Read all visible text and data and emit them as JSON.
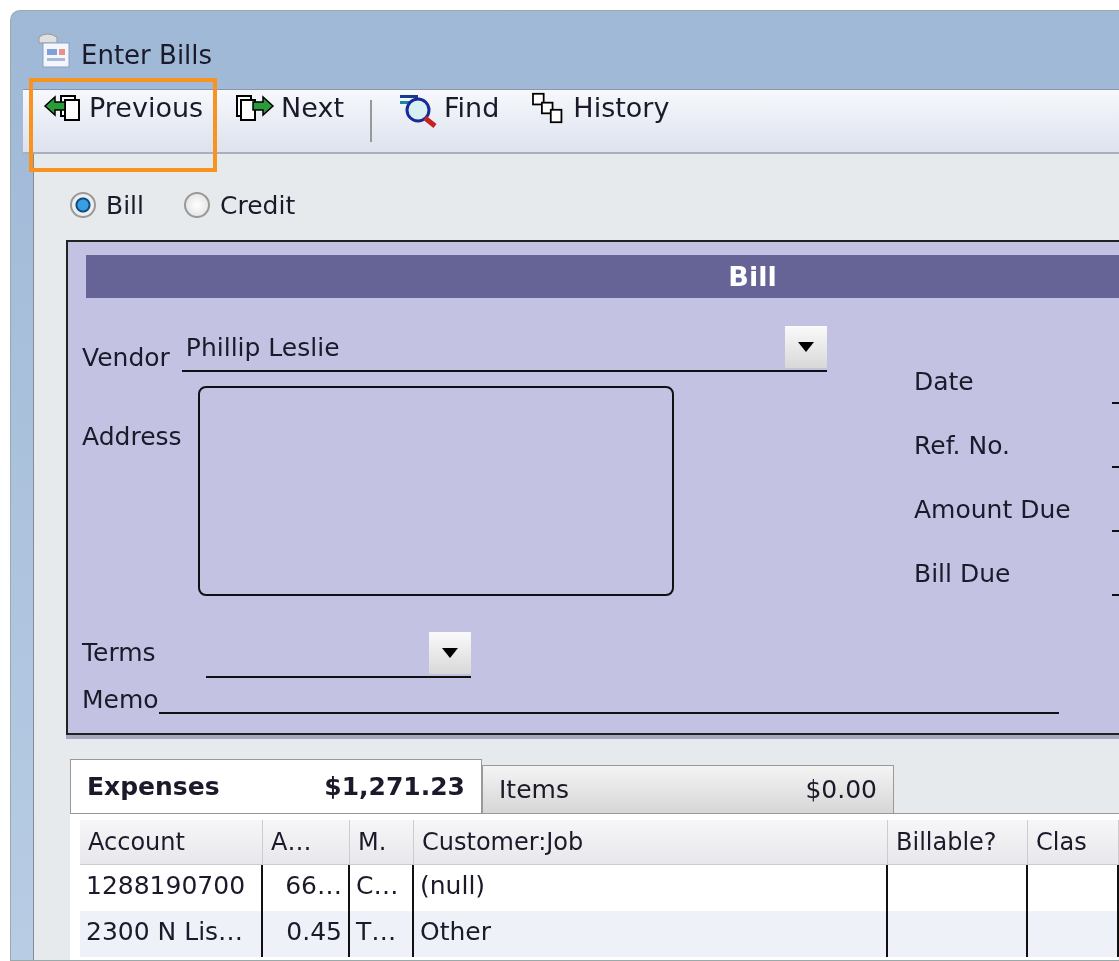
{
  "window": {
    "title": "Enter Bills"
  },
  "toolbar": [
    {
      "label": "Previous",
      "kind": "previous",
      "highlighted": true
    },
    {
      "label": "Next",
      "kind": "next",
      "highlighted": false
    },
    {
      "label": "Find",
      "kind": "find",
      "highlighted": false
    },
    {
      "label": "History",
      "kind": "history",
      "highlighted": false
    }
  ],
  "bill_type": [
    {
      "label": "Bill",
      "selected": true
    },
    {
      "label": "Credit",
      "selected": false
    }
  ],
  "form": {
    "header": "Bill",
    "vendor": {
      "label": "Vendor",
      "value": "Phillip Leslie"
    },
    "address_label": "Address",
    "terms_label": "Terms",
    "memo_label": "Memo",
    "right_fields": [
      {
        "label": "Date"
      },
      {
        "label": "Ref. No."
      },
      {
        "label": "Amount Due"
      },
      {
        "label": "Bill Due"
      }
    ]
  },
  "tabs": [
    {
      "label": "Expenses",
      "amount": "$1,271.23",
      "selected": true
    },
    {
      "label": "Items",
      "amount": "$0.00",
      "selected": false
    }
  ],
  "table": {
    "columns": [
      "Account",
      "A…",
      "M.",
      "Customer:Job",
      "Billable?",
      "Clas"
    ],
    "rows": [
      [
        "1288190700",
        "66…",
        "C…",
        "(null)",
        "",
        ""
      ],
      [
        "2300 N Lis…",
        "0.45",
        "T…",
        "Other",
        "",
        ""
      ]
    ]
  }
}
